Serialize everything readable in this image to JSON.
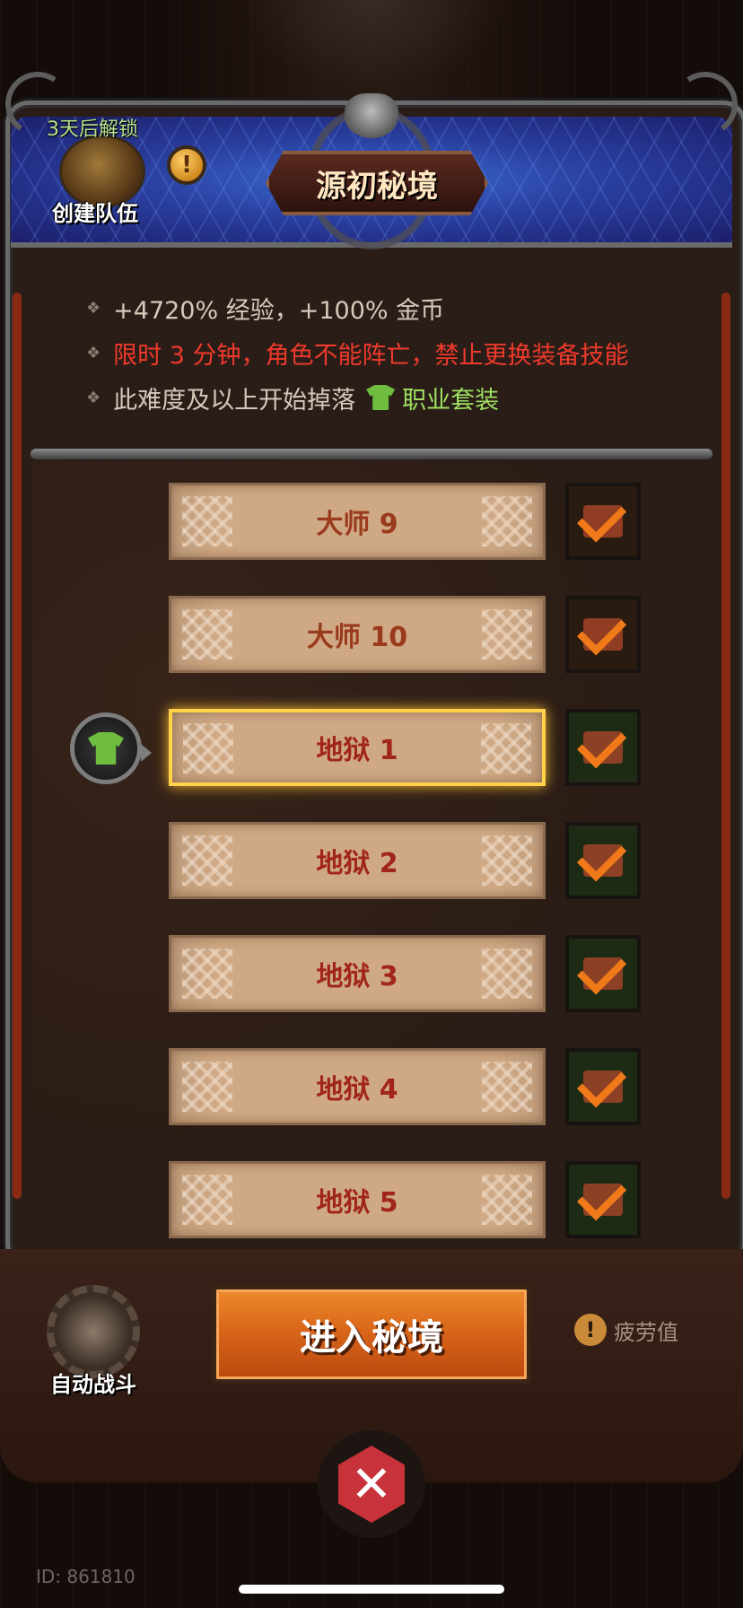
{
  "header": {
    "unlock_text": "3天后解锁",
    "team_label": "创建队伍",
    "info_icon": "!",
    "title": "源初秘境"
  },
  "info": {
    "line1": "+4720% 经验，+100% 金币",
    "line2": "限时 3 分钟，角色不能阵亡，禁止更换装备技能",
    "line3_prefix": "此难度及以上开始掉落",
    "line3_item": "职业套装"
  },
  "difficulties": [
    {
      "label": "大师 9",
      "checked": true
    },
    {
      "label": "大师 10",
      "checked": true
    },
    {
      "label": "地狱 1",
      "checked": true,
      "selected": true
    },
    {
      "label": "地狱 2",
      "checked": true
    },
    {
      "label": "地狱 3",
      "checked": true
    },
    {
      "label": "地狱 4",
      "checked": true
    },
    {
      "label": "地狱 5",
      "checked": true
    }
  ],
  "bottom": {
    "auto_label": "自动战斗",
    "enter_label": "进入秘境",
    "fatigue_icon": "!",
    "fatigue_label": "疲劳值"
  },
  "footer": {
    "id_text": "ID: 861810"
  },
  "colors": {
    "accent_orange": "#d9661a",
    "difficulty_red": "#a1251a",
    "warning_red": "#ef3a2b",
    "set_green": "#9ee061",
    "selected_gold": "#ffd24a"
  },
  "icons": {
    "team": "helmet-icon",
    "set_item": "shirt-icon",
    "auto": "hourglass-gear-icon",
    "battle": "crossed-swords-icon"
  }
}
